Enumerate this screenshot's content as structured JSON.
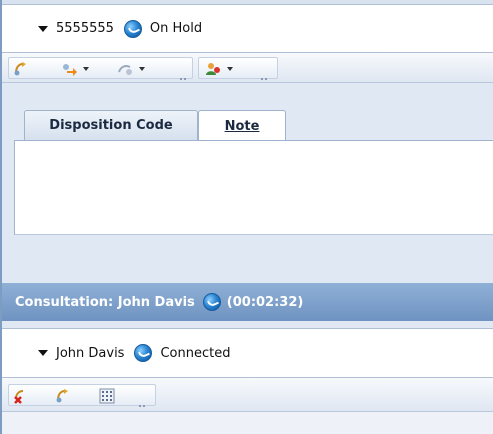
{
  "call": {
    "number": "5555555",
    "status": "On Hold"
  },
  "tabs": [
    {
      "label": "Disposition Code",
      "active": false
    },
    {
      "label": "Note",
      "active": true
    }
  ],
  "note": {
    "value": ""
  },
  "consultation": {
    "label": "Consultation: John Davis",
    "timer": "(00:02:32)"
  },
  "consult_call": {
    "name": "John Davis",
    "status": "Connected"
  },
  "icons": {
    "status": "connected-globe-icon",
    "toolbar1": [
      "transfer-icon",
      "forward-icon",
      "conference-icon",
      "agent-icon"
    ],
    "toolbar2": [
      "hangup-icon",
      "complete-transfer-icon",
      "keypad-icon"
    ]
  },
  "colors": {
    "consultation_bar": "#7a9cc8",
    "panel_bg": "#dfe8f3"
  }
}
